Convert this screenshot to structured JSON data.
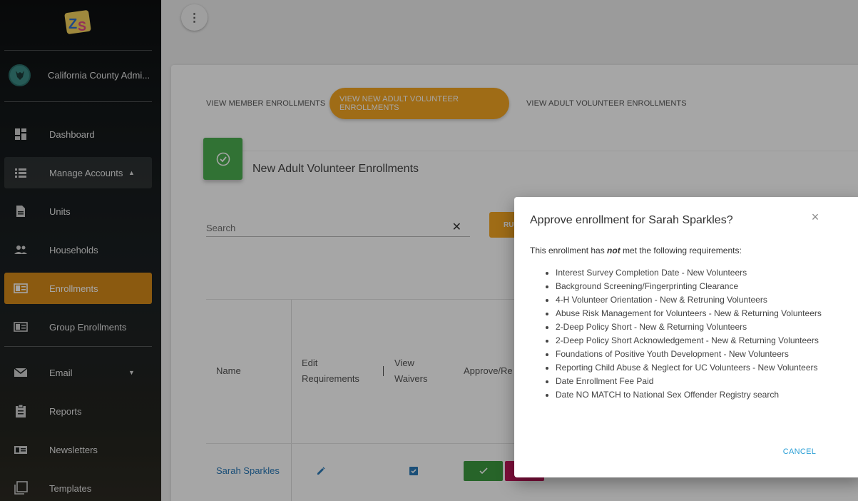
{
  "app": {
    "logo_text": "ZS"
  },
  "user": {
    "name": "California County Admi..."
  },
  "sidebar": {
    "items": [
      {
        "label": "Dashboard",
        "icon": "dashboard-icon"
      },
      {
        "label": "Manage Accounts",
        "icon": "list-icon",
        "expanded": true
      },
      {
        "label": "Units",
        "icon": "document-icon"
      },
      {
        "label": "Households",
        "icon": "people-icon"
      },
      {
        "label": "Enrollments",
        "icon": "card-icon",
        "active": true
      },
      {
        "label": "Group Enrollments",
        "icon": "card-icon"
      },
      {
        "label": "Email",
        "icon": "mail-icon",
        "has_caret": true
      },
      {
        "label": "Reports",
        "icon": "clipboard-icon"
      },
      {
        "label": "Newsletters",
        "icon": "newsletter-icon"
      },
      {
        "label": "Templates",
        "icon": "templates-icon"
      }
    ]
  },
  "tabs": [
    {
      "label": "View Member Enrollments",
      "active": false
    },
    {
      "label": "View New Adult Volunteer Enrollments",
      "active": true
    },
    {
      "label": "View Adult Volunteer Enrollments",
      "active": false
    }
  ],
  "section": {
    "title": "New Adult Volunteer Enrollments"
  },
  "search": {
    "placeholder": "Search",
    "value": ""
  },
  "run_button": {
    "label": "RU"
  },
  "table": {
    "headers": [
      "Name",
      "Edit Requirements",
      "View Waivers",
      "Approve/Re"
    ],
    "rows": [
      {
        "name": "Sarah Sparkles"
      }
    ]
  },
  "modal": {
    "title": "Approve enrollment for Sarah Sparkles?",
    "intro_before": "This enrollment has ",
    "intro_emphasis": "not",
    "intro_after": " met the following requirements:",
    "requirements": [
      "Interest Survey Completion Date - New Volunteers",
      "Background Screening/Fingerprinting Clearance",
      "4-H Volunteer Orientation - New & Retruning Volunteers",
      "Abuse Risk Management for Volunteers - New & Returning Volunteers",
      "2-Deep Policy Short - New & Returning Volunteers",
      "2-Deep Policy Short Acknowledgement - New & Returning Volunteers",
      "Foundations of Positive Youth Development - New Volunteers",
      "Reporting Child Abuse & Neglect for UC Volunteers - New Volunteers",
      "Date Enrollment Fee Paid",
      "Date NO MATCH to National Sex Offender Registry search"
    ],
    "cancel_label": "Cancel"
  },
  "colors": {
    "accent": "#f5a623",
    "active_nav": "#d68a1a",
    "success": "#4caf50",
    "link": "#2a7ab8",
    "cancel": "#2a9fd6"
  }
}
